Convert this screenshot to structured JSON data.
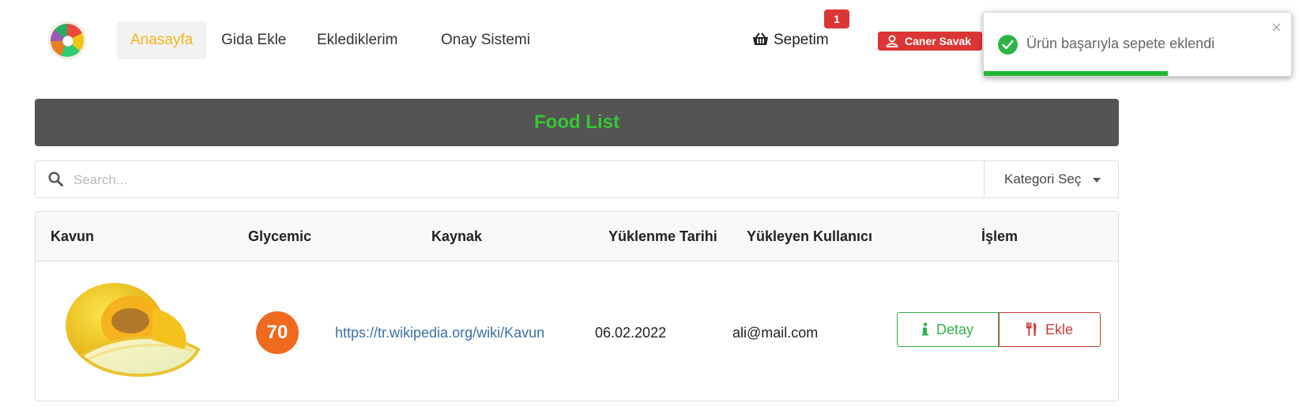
{
  "nav": {
    "items": [
      {
        "label": "Anasayfa",
        "active": true
      },
      {
        "label": "Gida Ekle"
      },
      {
        "label": "Eklediklerim"
      },
      {
        "label": "Onay Sistemi"
      }
    ],
    "cart_label": "Sepetim",
    "cart_count": "1",
    "user_name": "Caner Savak",
    "logo_icon": "food-plate-logo-icon"
  },
  "toast": {
    "message": "Ürün başarıyla sepete eklendi",
    "close": "×",
    "icon": "check-circle-icon",
    "progress": 0.6
  },
  "header": {
    "title": "Food List"
  },
  "search": {
    "placeholder": "Search...",
    "category_label": "Kategori Seç"
  },
  "table": {
    "columns": [
      "Kavun",
      "Glycemic",
      "Kaynak",
      "Yüklenme Tarihi",
      "Yükleyen Kullanıcı",
      "İşlem"
    ],
    "rows": [
      {
        "image": "melon-image",
        "glycemic": "70",
        "source": "https://tr.wikipedia.org/wiki/Kavun",
        "date": "06.02.2022",
        "user": "ali@mail.com",
        "detail_label": "Detay",
        "add_label": "Ekle"
      }
    ]
  },
  "colors": {
    "active_nav": "#f4b41a",
    "danger": "#dc3535",
    "success": "#2fb344",
    "header_bg": "#545454",
    "header_title": "#32c832",
    "glycemic_badge": "#ee6a1f"
  }
}
